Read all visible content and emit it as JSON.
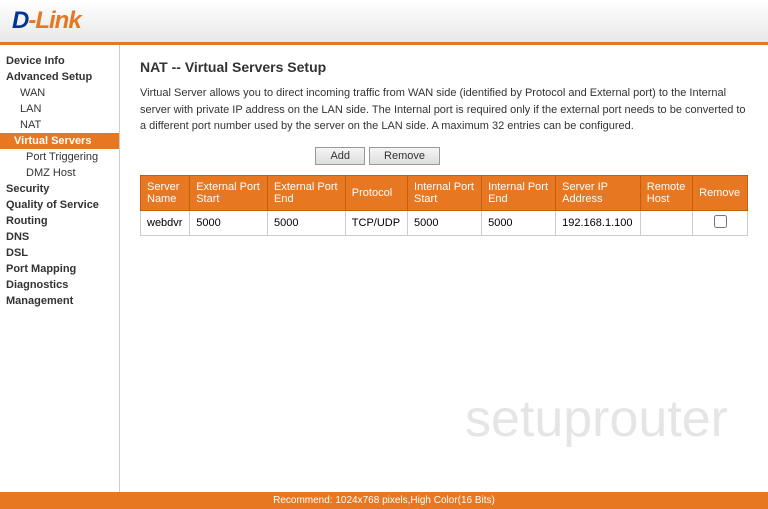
{
  "header": {
    "logo_dlink": "D-Link"
  },
  "sidebar": {
    "sections": [
      {
        "label": "Device Info",
        "type": "section",
        "name": "device-info"
      },
      {
        "label": "Advanced Setup",
        "type": "section",
        "name": "advanced-setup"
      },
      {
        "label": "WAN",
        "type": "subsection",
        "name": "wan"
      },
      {
        "label": "LAN",
        "type": "subsection",
        "name": "lan"
      },
      {
        "label": "NAT",
        "type": "subsection",
        "name": "nat"
      },
      {
        "label": "Virtual Servers",
        "type": "subsection-active",
        "name": "virtual-servers"
      },
      {
        "label": "Port Triggering",
        "type": "subsection2",
        "name": "port-triggering"
      },
      {
        "label": "DMZ Host",
        "type": "subsection2",
        "name": "dmz-host"
      },
      {
        "label": "Security",
        "type": "section",
        "name": "security"
      },
      {
        "label": "Quality of Service",
        "type": "section",
        "name": "qos"
      },
      {
        "label": "Routing",
        "type": "section",
        "name": "routing"
      },
      {
        "label": "DNS",
        "type": "section",
        "name": "dns"
      },
      {
        "label": "DSL",
        "type": "section",
        "name": "dsl"
      },
      {
        "label": "Port Mapping",
        "type": "section",
        "name": "port-mapping"
      },
      {
        "label": "Diagnostics",
        "type": "section",
        "name": "diagnostics"
      },
      {
        "label": "Management",
        "type": "section",
        "name": "management"
      }
    ]
  },
  "main": {
    "title": "NAT -- Virtual Servers Setup",
    "description": "Virtual Server allows you to direct incoming traffic from WAN side (identified by Protocol and External port) to the Internal server with private IP address on the LAN side. The Internal port is required only if the external port needs to be converted to a different port number used by the server on the LAN side. A maximum 32 entries can be configured.",
    "buttons": {
      "add": "Add",
      "remove": "Remove"
    },
    "table": {
      "columns": [
        "Server Name",
        "External Port Start",
        "External Port End",
        "Protocol",
        "Internal Port Start",
        "Internal Port End",
        "Server IP Address",
        "Remote Host",
        "Remove"
      ],
      "rows": [
        {
          "server_name": "webdvr",
          "ext_port_start": "5000",
          "ext_port_end": "5000",
          "protocol": "TCP/UDP",
          "int_port_start": "5000",
          "int_port_end": "5000",
          "server_ip": "192.168.1.100",
          "remote_host": "",
          "remove": "☐"
        }
      ]
    },
    "watermark": "setuprouter"
  },
  "footer": {
    "text": "Recommend: 1024x768 pixels,High Color(16 Bits)"
  }
}
